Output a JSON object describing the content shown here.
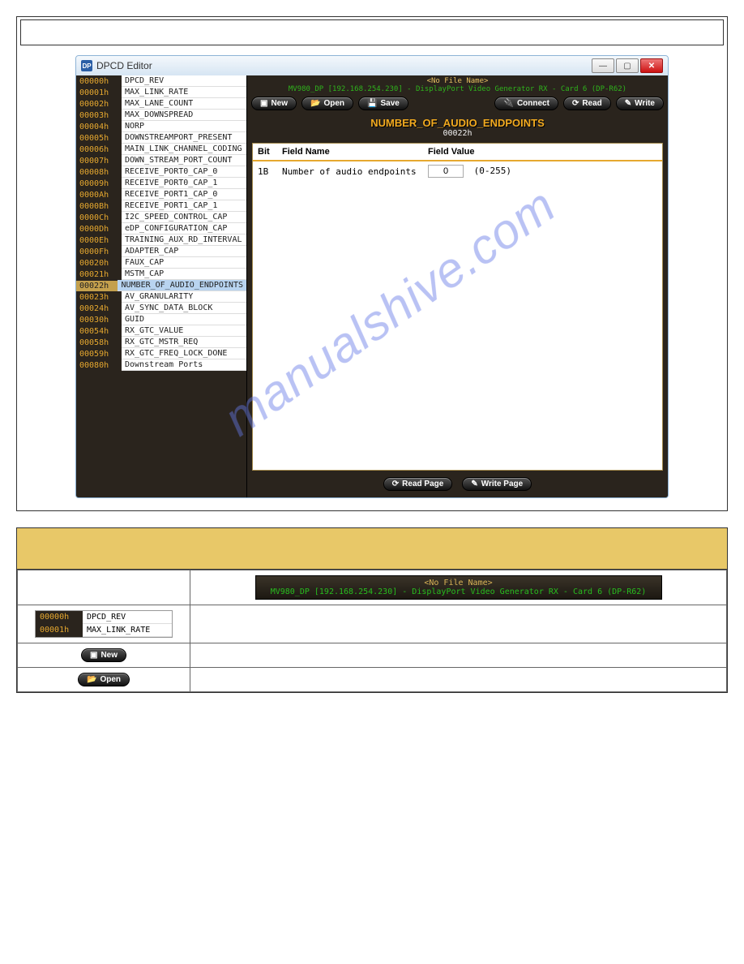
{
  "watermark": "manualshive.com",
  "window": {
    "icon_text": "DP",
    "title": "DPCD Editor"
  },
  "status": {
    "file": "<No File Name>",
    "connection": "MV980_DP [192.168.254.230] - DisplayPort Video Generator RX - Card 6  (DP-R62)"
  },
  "toolbar": {
    "new": "New",
    "open": "Open",
    "save": "Save",
    "connect": "Connect",
    "read": "Read",
    "write": "Write"
  },
  "page_title": {
    "name": "NUMBER_OF_AUDIO_ENDPOINTS",
    "addr": "00022h"
  },
  "detail": {
    "headers": {
      "bit": "Bit",
      "fname": "Field Name",
      "fval": "Field Value"
    },
    "rows": [
      {
        "bit": "1B",
        "fname": "Number of audio endpoints",
        "value": "0",
        "range": "(0-255)"
      }
    ]
  },
  "bottom_toolbar": {
    "read_page": "Read Page",
    "write_page": "Write Page"
  },
  "sidebar": [
    {
      "addr": "00000h",
      "name": "DPCD_REV"
    },
    {
      "addr": "00001h",
      "name": "MAX_LINK_RATE"
    },
    {
      "addr": "00002h",
      "name": "MAX_LANE_COUNT"
    },
    {
      "addr": "00003h",
      "name": "MAX_DOWNSPREAD"
    },
    {
      "addr": "00004h",
      "name": "NORP"
    },
    {
      "addr": "00005h",
      "name": "DOWNSTREAMPORT_PRESENT"
    },
    {
      "addr": "00006h",
      "name": "MAIN_LINK_CHANNEL_CODING"
    },
    {
      "addr": "00007h",
      "name": "DOWN_STREAM_PORT_COUNT"
    },
    {
      "addr": "00008h",
      "name": "RECEIVE_PORT0_CAP_0"
    },
    {
      "addr": "00009h",
      "name": "RECEIVE_PORT0_CAP_1"
    },
    {
      "addr": "0000Ah",
      "name": "RECEIVE_PORT1_CAP_0"
    },
    {
      "addr": "0000Bh",
      "name": "RECEIVE_PORT1_CAP_1"
    },
    {
      "addr": "0000Ch",
      "name": "I2C_SPEED_CONTROL_CAP"
    },
    {
      "addr": "0000Dh",
      "name": "eDP_CONFIGURATION_CAP"
    },
    {
      "addr": "0000Eh",
      "name": "TRAINING_AUX_RD_INTERVAL"
    },
    {
      "addr": "0000Fh",
      "name": "ADAPTER_CAP"
    },
    {
      "addr": "00020h",
      "name": "FAUX_CAP"
    },
    {
      "addr": "00021h",
      "name": "MSTM_CAP"
    },
    {
      "addr": "00022h",
      "name": "NUMBER_OF_AUDIO_ENDPOINTS",
      "selected": true
    },
    {
      "addr": "00023h",
      "name": "AV_GRANULARITY"
    },
    {
      "addr": "00024h",
      "name": "AV_SYNC_DATA_BLOCK"
    },
    {
      "addr": "00030h",
      "name": "GUID"
    },
    {
      "addr": "00054h",
      "name": "RX_GTC_VALUE"
    },
    {
      "addr": "00058h",
      "name": "RX_GTC_MSTR_REQ"
    },
    {
      "addr": "00059h",
      "name": "RX_GTC_FREQ_LOCK_DONE"
    },
    {
      "addr": "00080h",
      "name": "Downstream Ports"
    }
  ],
  "lower": {
    "status_file": "<No File Name>",
    "status_conn": "MV980_DP [192.168.254.230] - DisplayPort Video Generator RX - Card 6  (DP-R62)",
    "mini_rows": [
      {
        "addr": "00000h",
        "name": "DPCD_REV"
      },
      {
        "addr": "00001h",
        "name": "MAX_LINK_RATE"
      }
    ],
    "new_btn": "New",
    "open_btn": "Open"
  }
}
